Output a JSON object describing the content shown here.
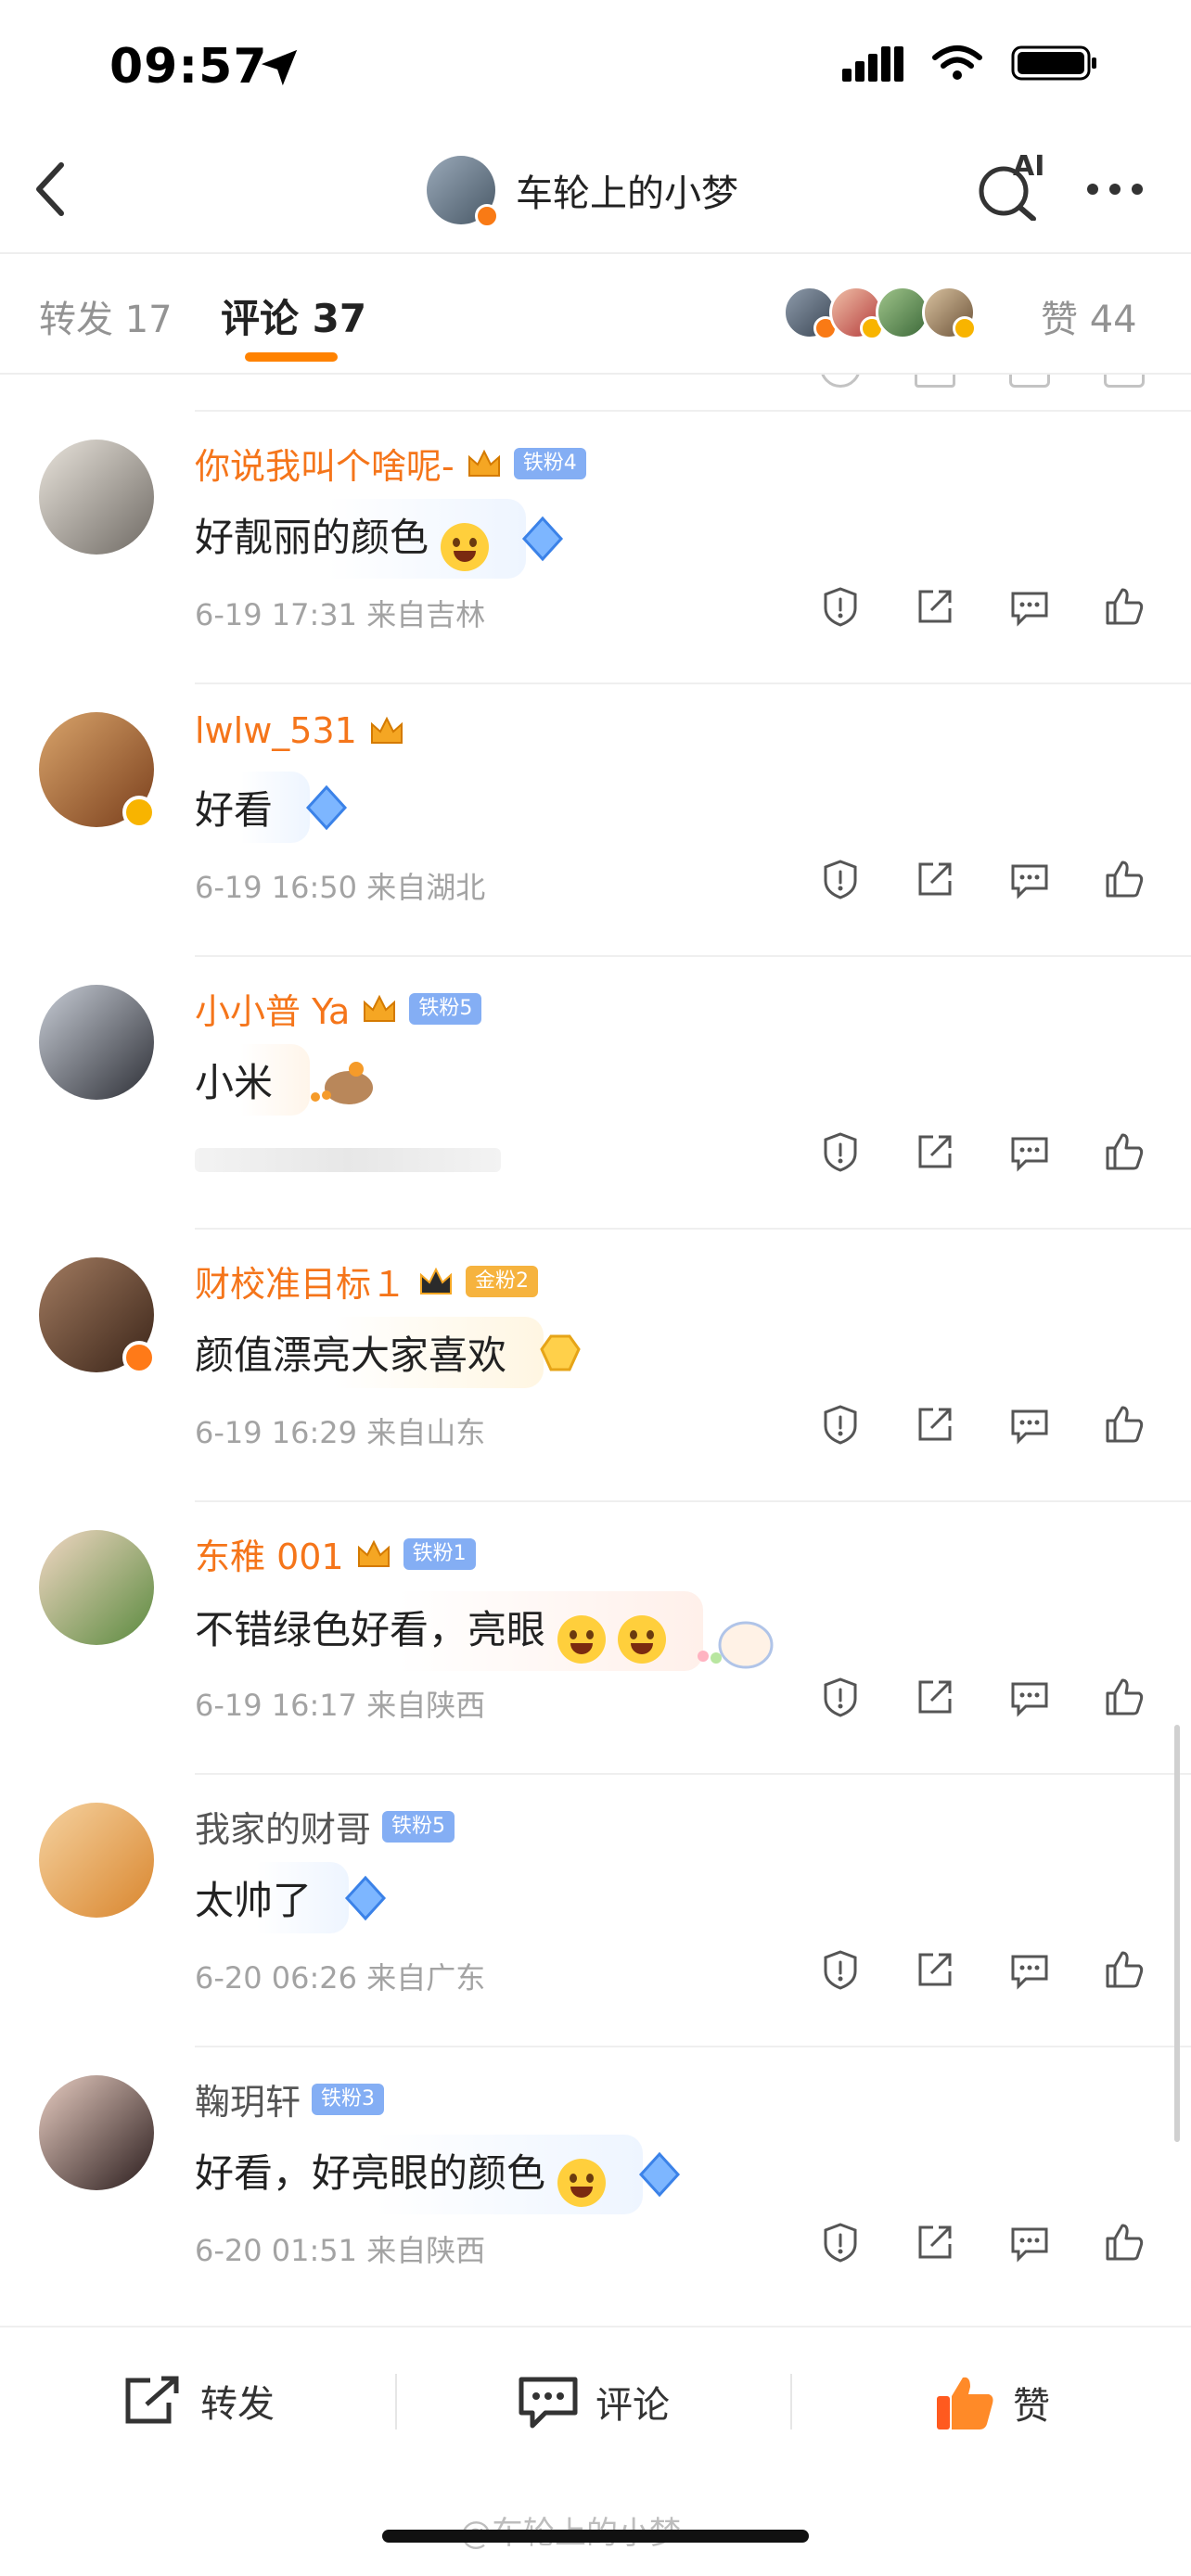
{
  "status_bar": {
    "time": "09:57"
  },
  "nav": {
    "title": "车轮上的小梦",
    "ai_label": "AI"
  },
  "tabs": {
    "repost": "转发 17",
    "comment": "评论 37",
    "like": "赞 44"
  },
  "comments": [
    {
      "name": "你说我叫个啥呢-",
      "fan_badge": "铁粉4",
      "text": "好靓丽的颜色",
      "meta": "6-19 17:31  来自吉林"
    },
    {
      "name": "lwlw_531",
      "fan_badge": "",
      "text": "好看",
      "meta": "6-19 16:50  来自湖北"
    },
    {
      "name": "小小普 Ya",
      "fan_badge": "铁粉5",
      "text": "小米",
      "meta": ""
    },
    {
      "name": "财校准目标１",
      "fan_badge": "金粉2",
      "text": "颜值漂亮大家喜欢",
      "meta": "6-19 16:29  来自山东"
    },
    {
      "name": "东稚 001",
      "fan_badge": "铁粉1",
      "text": "不错绿色好看，亮眼",
      "meta": "6-19 16:17  来自陕西"
    },
    {
      "name": "我家的财哥",
      "fan_badge": "铁粉5",
      "text": "太帅了",
      "meta": "6-20 06:26  来自广东"
    },
    {
      "name": "鞠玥轩",
      "fan_badge": "铁粉3",
      "text": "好看，好亮眼的颜色",
      "meta": "6-20 01:51  来自陕西"
    }
  ],
  "bottom_bar": {
    "repost": "转发",
    "comment": "评论",
    "like": "赞"
  },
  "watermark": "@车轮上的小梦",
  "colors": {
    "accent": "#ff8200",
    "name_orange": "#f5751a",
    "fan_blue": "#84aef4",
    "fan_gold": "#f6b33e"
  }
}
